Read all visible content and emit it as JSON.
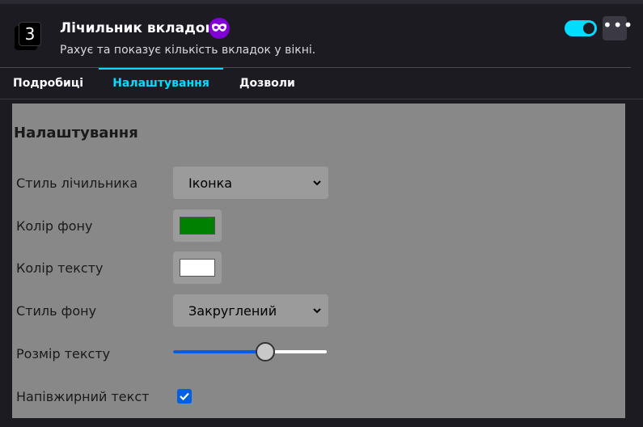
{
  "extension": {
    "icon_number": "3",
    "title": "Лічильник вкладок",
    "description": "Рахує та показує кількість вкладок у вікні.",
    "private_icon": "private-browsing-mask-icon",
    "enabled": true
  },
  "header": {
    "more_label": "•••"
  },
  "tabs": [
    {
      "label": "Подробиці",
      "active": false
    },
    {
      "label": "Налаштування",
      "active": true
    },
    {
      "label": "Дозволи",
      "active": false
    }
  ],
  "settings": {
    "title": "Налаштування",
    "counter_style": {
      "label": "Стиль лічильника",
      "value": "Іконка"
    },
    "bg_color": {
      "label": "Колір фону",
      "value": "#008000"
    },
    "text_color": {
      "label": "Колір тексту",
      "value": "#ffffff"
    },
    "bg_style": {
      "label": "Стиль фону",
      "value": "Закруглений"
    },
    "text_size": {
      "label": "Розмір тексту",
      "fraction": 0.6
    },
    "bold_text": {
      "label": "Напівжирний текст",
      "checked": true
    }
  },
  "colors": {
    "accent": "#00ddff",
    "background": "#1c1b22",
    "panel": "#888888",
    "private": "#8000d7",
    "checkbox": "#0060df"
  }
}
